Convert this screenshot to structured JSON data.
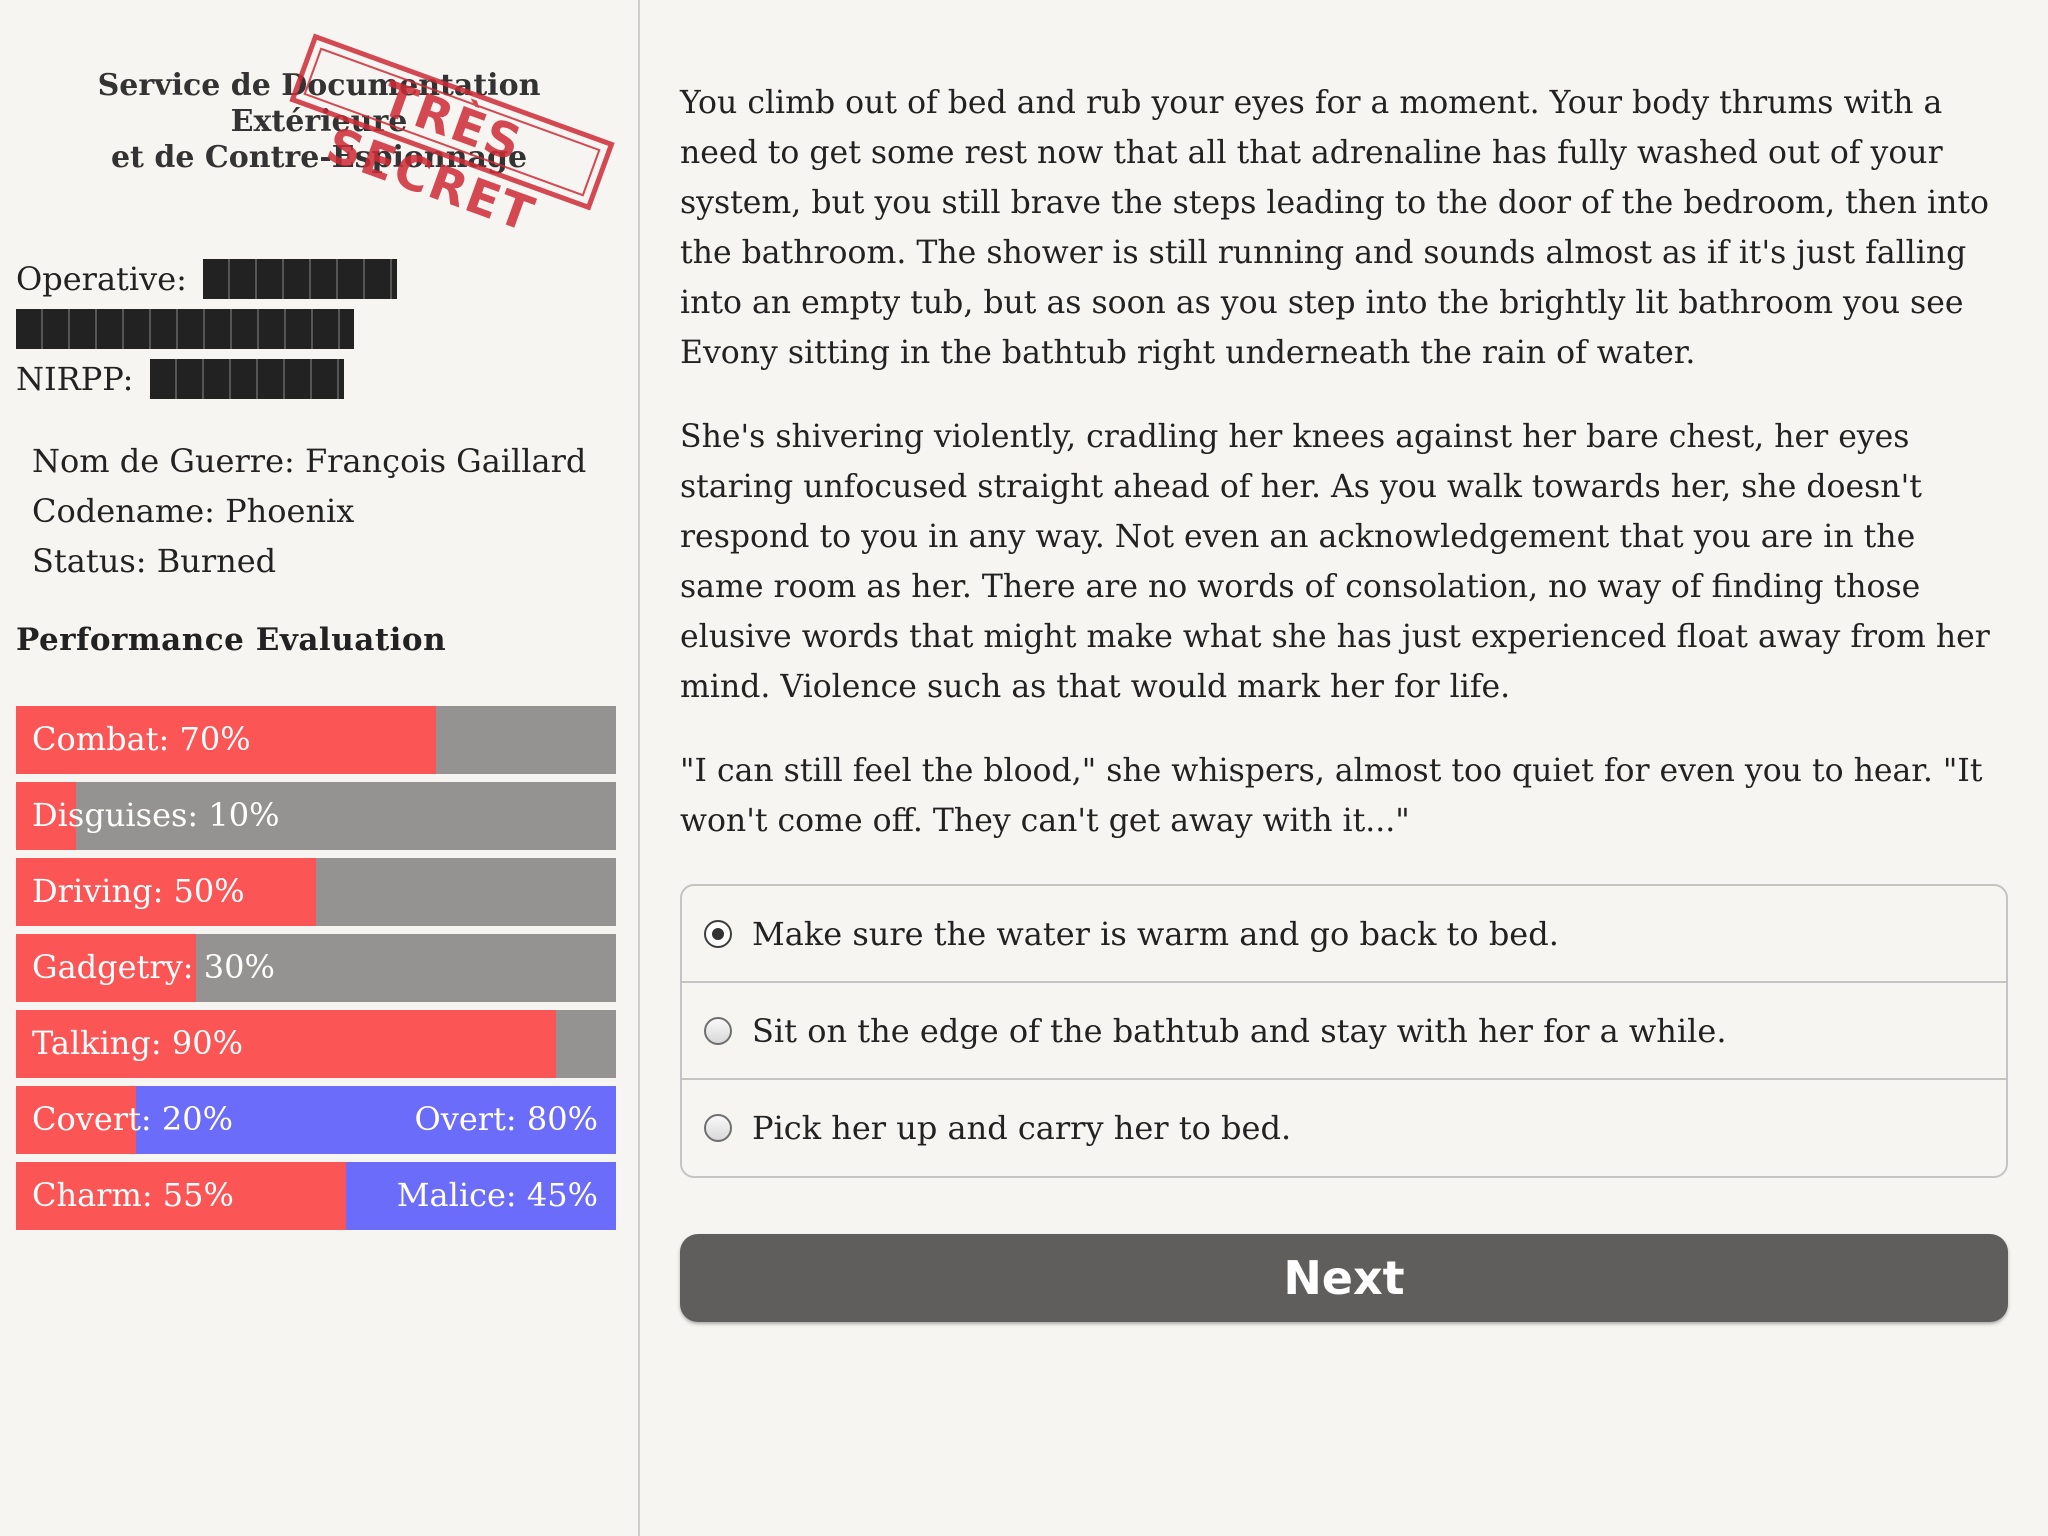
{
  "sidebar": {
    "agency_line1": "Service de Documentation Extérieure",
    "agency_line2": "et de Contre-Espionnage",
    "stamp_text": "TRÈS SECRET",
    "operative_label": "Operative:",
    "nirpp_label": "NIRPP:",
    "nom_de_guerre": "Nom de Guerre: François Gaillard",
    "codename": "Codename: Phoenix",
    "status": "Status: Burned",
    "performance_title": "Performance Evaluation",
    "stats": [
      {
        "label": "Combat: 70%",
        "value": 0.7
      },
      {
        "label": "Disguises: 10%",
        "value": 0.1
      },
      {
        "label": "Driving: 50%",
        "value": 0.5
      },
      {
        "label": "Gadgetry: 30%",
        "value": 0.3
      },
      {
        "label": "Talking: 90%",
        "value": 0.9
      }
    ],
    "opposed_stats": [
      {
        "left_label": "Covert: 20%",
        "right_label": "Overt: 80%",
        "value": 0.2
      },
      {
        "left_label": "Charm: 55%",
        "right_label": "Malice: 45%",
        "value": 0.55
      }
    ]
  },
  "story": {
    "paragraphs": [
      "You climb out of bed and rub your eyes for a moment. Your body thrums with a need to get some rest now that all that adrenaline has fully washed out of your system, but you still brave the steps leading to the door of the bedroom, then into the bathroom. The shower is still running and sounds almost as if it's just falling into an empty tub, but as soon as you step into the brightly lit bathroom you see Evony sitting in the bathtub right underneath the rain of water.",
      "She's shivering violently, cradling her knees against her bare chest, her eyes staring unfocused straight ahead of her. As you walk towards her, she doesn't respond to you in any way. Not even an acknowledgement that you are in the same room as her. There are no words of consolation, no way of finding those elusive words that might make what she has just experienced float away from her mind. Violence such as that would mark her for life.",
      "\"I can still feel the blood,\" she whispers, almost too quiet for even you to hear. \"It won't come off. They can't get away with it...\""
    ]
  },
  "choices": [
    {
      "label": "Make sure the water is warm and go back to bed.",
      "selected": true
    },
    {
      "label": "Sit on the edge of the bathtub and stay with her for a while.",
      "selected": false
    },
    {
      "label": "Pick her up and carry her to bed.",
      "selected": false
    }
  ],
  "next_label": "Next",
  "colors": {
    "bar_fill": "#fb5655",
    "bar_track": "#959391",
    "bar_opposed": "#6c6cfb",
    "stamp": "#cf2a35",
    "button": "#5f5e5d"
  }
}
